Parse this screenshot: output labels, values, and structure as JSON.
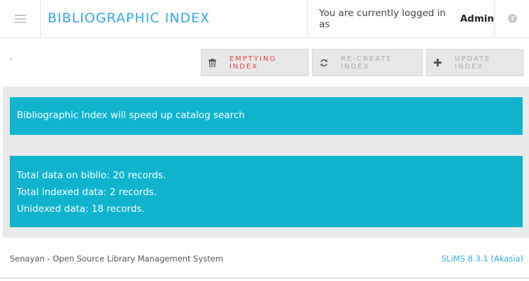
{
  "header": {
    "title": "BIBLIOGRAPHIC INDEX",
    "login_prefix": "You are currently logged in as",
    "username": "Admin"
  },
  "toolbar": {
    "dot": ".",
    "empty_label": "EMPTYING INDEX",
    "recreate_label": "RE-CREATE INDEX",
    "update_label": "UPDATE INDEX"
  },
  "main": {
    "info_text": "Bibliographic Index will speed up catalog search",
    "stats": [
      "Total data on biblio: 20 records.",
      "Total indexed data: 2 records.",
      "Unidexed data: 18 records."
    ]
  },
  "footer": {
    "left_text": "Senayan - Open Source Library Management System",
    "version_link": "SLiMS 8.3.1 (Akasia)"
  },
  "colors": {
    "accent": "#33aadd",
    "alert_bg": "#10b4cf",
    "danger": "#e04040"
  },
  "icons": [
    "menu-icon",
    "help-icon",
    "trash-icon",
    "refresh-icon",
    "plus-icon"
  ]
}
